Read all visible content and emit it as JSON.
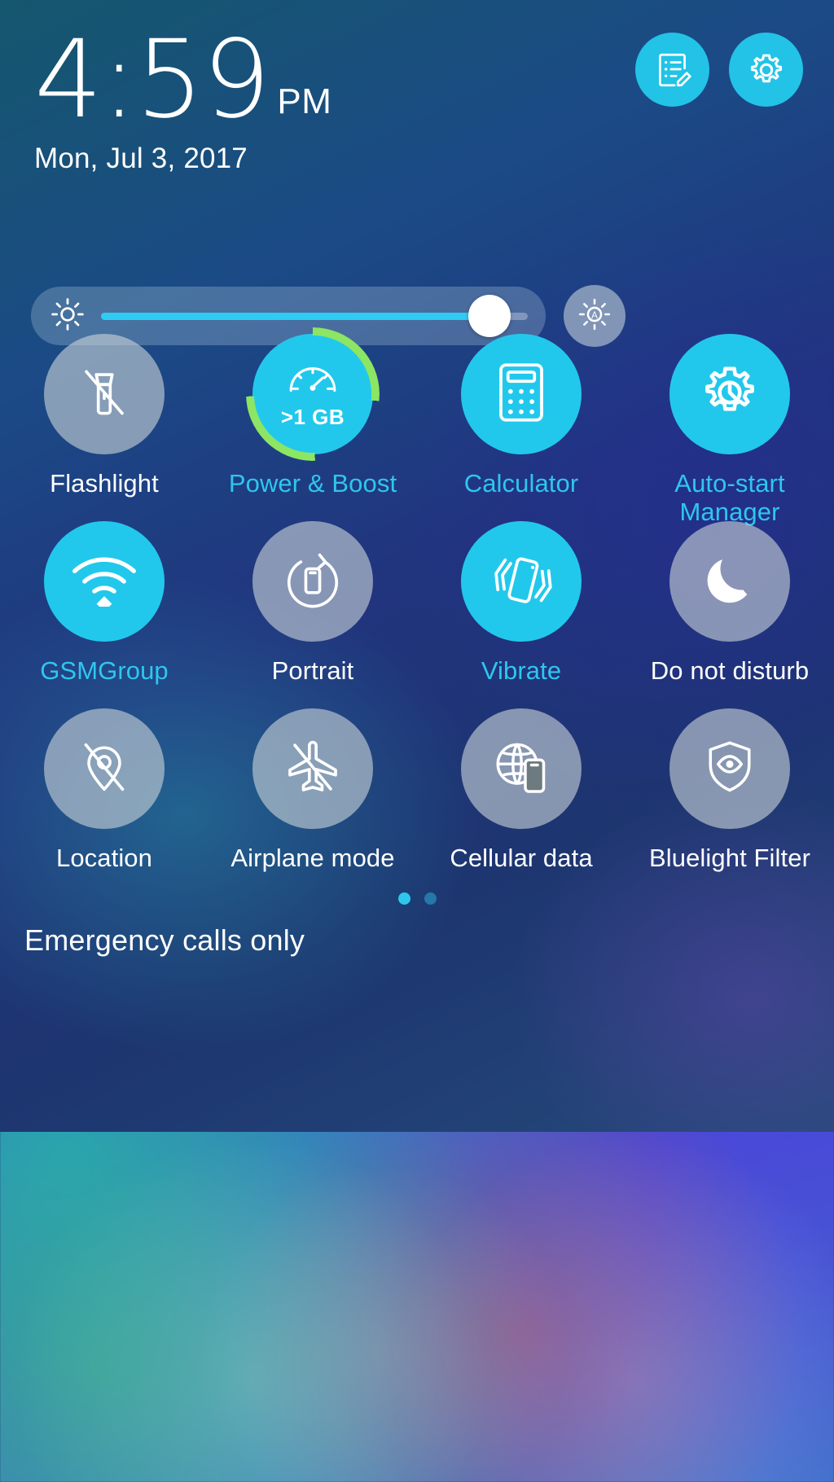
{
  "status_bar": {
    "time": "4:59",
    "meridiem": "PM",
    "date": "Mon, Jul 3, 2017",
    "carrier_status": "Emergency calls only"
  },
  "header_actions": [
    {
      "name": "edit-shortcuts-button",
      "icon": "edit-note-icon",
      "color": "#22c3e6"
    },
    {
      "name": "settings-button",
      "icon": "gear-icon",
      "color": "#22c3e6"
    }
  ],
  "brightness": {
    "icon": "brightness-sun-icon",
    "level": 91,
    "auto_icon": "auto-brightness-icon",
    "auto_enabled": false
  },
  "tiles": [
    {
      "label": "Flashlight",
      "icon": "flashlight-off-icon",
      "state": "off"
    },
    {
      "label": "Power & Boost",
      "icon": "speed-gauge-icon",
      "state": "on",
      "badge": ">1 GB",
      "ring_color": "#8ce563"
    },
    {
      "label": "Calculator",
      "icon": "calculator-icon",
      "state": "on"
    },
    {
      "label": "Auto-start Manager",
      "icon": "autostart-gear-icon",
      "state": "on"
    },
    {
      "label": "GSMGroup",
      "icon": "wifi-icon",
      "state": "on"
    },
    {
      "label": "Portrait",
      "icon": "screen-rotation-icon",
      "state": "off"
    },
    {
      "label": "Vibrate",
      "icon": "vibrate-icon",
      "state": "on"
    },
    {
      "label": "Do not disturb",
      "icon": "moon-icon",
      "state": "off"
    },
    {
      "label": "Location",
      "icon": "location-off-icon",
      "state": "off"
    },
    {
      "label": "Airplane mode",
      "icon": "airplane-off-icon",
      "state": "off"
    },
    {
      "label": "Cellular data",
      "icon": "cellular-data-icon",
      "state": "off"
    },
    {
      "label": "Bluelight Filter",
      "icon": "shield-eye-icon",
      "state": "off"
    }
  ],
  "pagination": {
    "pages": 2,
    "active_page": 1
  },
  "colors": {
    "accent_on": "#22c8ec",
    "label_on": "#2fc6ee",
    "tile_off": "rgba(200,210,215,0.62)",
    "slider_fill": "#2ecbf2",
    "boost_ring": "#8ce563"
  }
}
